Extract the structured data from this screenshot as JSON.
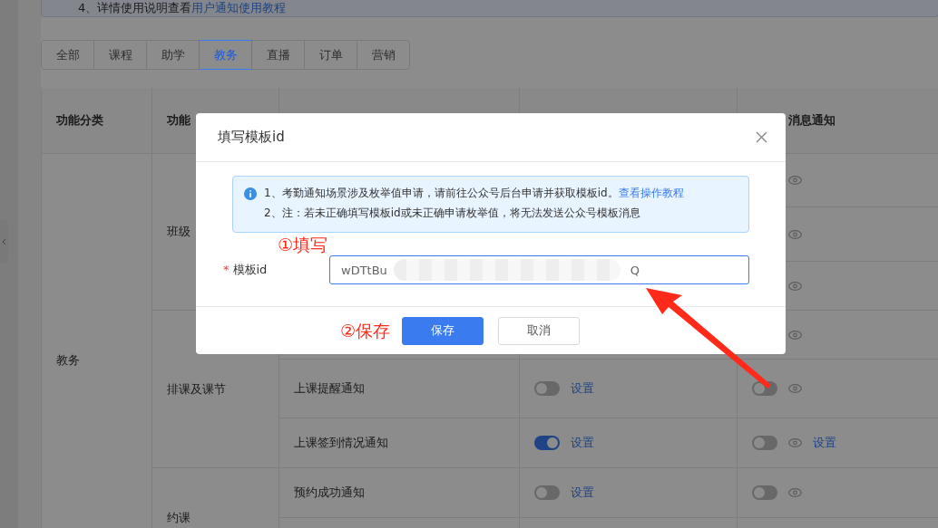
{
  "notice": {
    "text": "4、详情使用说明查看",
    "link": "用户通知使用教程"
  },
  "tabs": [
    {
      "label": "全部",
      "selected": false
    },
    {
      "label": "课程",
      "selected": false
    },
    {
      "label": "助学",
      "selected": false
    },
    {
      "label": "教务",
      "selected": true
    },
    {
      "label": "直播",
      "selected": false
    },
    {
      "label": "订单",
      "selected": false
    },
    {
      "label": "营销",
      "selected": false
    }
  ],
  "table": {
    "columns": [
      "功能分类",
      "功能",
      "",
      "",
      "消息通知"
    ],
    "groups": [
      {
        "category": "教务",
        "subgroups": [
          {
            "name": "班级",
            "rows": [
              {},
              {},
              {}
            ]
          },
          {
            "name": "排课及课节",
            "rows": [
              {},
              {
                "name": "上课提醒通知",
                "standard_on": false,
                "standard_link": "设置",
                "wechat_on": false
              },
              {
                "name": "上课签到情况通知",
                "standard_on": true,
                "standard_link": "设置",
                "wechat_on": false,
                "wechat_link": "设置"
              }
            ]
          },
          {
            "name": "约课",
            "rows": [
              {
                "name": "预约成功通知",
                "standard_on": false,
                "standard_link": "设置",
                "wechat_on": false
              },
              {}
            ]
          }
        ]
      }
    ]
  },
  "dialog": {
    "title": "填写模板id",
    "alert": {
      "line1": "1、考勤通知场景涉及枚举值申请，请前往公众号后台申请并获取模板id。",
      "link": "查看操作教程",
      "line2": "2、注：若未正确填写模板id或未正确申请枚举值，将无法发送公众号模板消息"
    },
    "field": {
      "label": "模板id",
      "required_mark": "*",
      "value_start": "wDTtBu",
      "value_end": "Q"
    },
    "buttons": [
      {
        "label": "保存",
        "kind": "primary"
      },
      {
        "label": "取消",
        "kind": "default"
      }
    ]
  },
  "annotations": [
    {
      "text": "①填写"
    },
    {
      "text": "②保存"
    }
  ]
}
